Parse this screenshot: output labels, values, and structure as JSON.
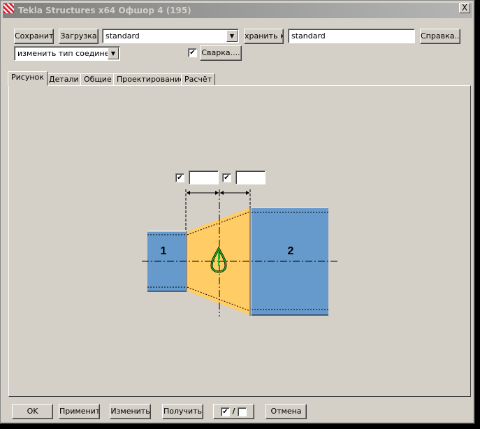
{
  "window": {
    "title": "Tekla Structures x64  Офшор 4 (195)",
    "close": "X"
  },
  "toolbar": {
    "save": "Сохранить",
    "load": "Загрузка",
    "preset": "standard",
    "save_as": "хранить к",
    "save_as_name": "standard",
    "help": "Справка...",
    "connection_type": "изменить тип соединения",
    "weld_checked": true,
    "weld": "Сварка...."
  },
  "tabs": [
    {
      "label": "Рисунок",
      "active": true
    },
    {
      "label": "Детали"
    },
    {
      "label": "Общие"
    },
    {
      "label": "Проектирование"
    },
    {
      "label": "Расчёт"
    }
  ],
  "figure": {
    "field1": "",
    "field2": "",
    "part1": "1",
    "part2": "2",
    "check1": true,
    "check2": true
  },
  "footer": {
    "ok": "OK",
    "apply": "Применить",
    "modify": "Изменить",
    "get": "Получить",
    "toggle_on": "✔",
    "toggle_sep": "/",
    "cancel": "Отмена"
  }
}
